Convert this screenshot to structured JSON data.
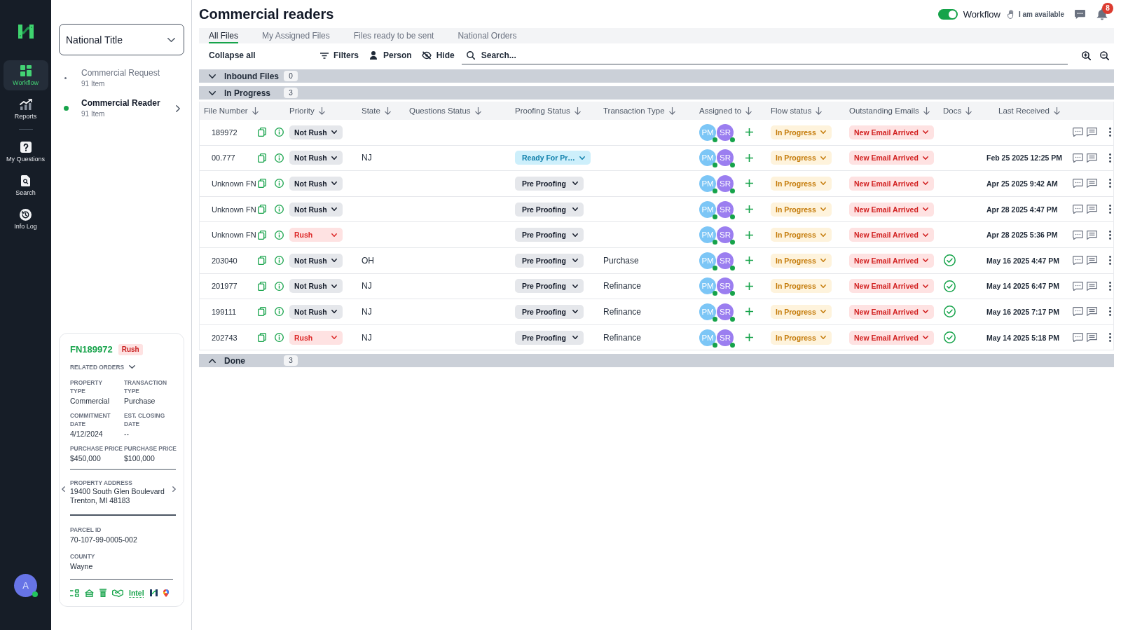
{
  "rail": {
    "nav": [
      {
        "label": "Workflow",
        "selected": true
      },
      {
        "label": "Reports",
        "selected": false
      },
      {
        "label": "My Questions",
        "selected": false
      },
      {
        "label": "Search",
        "selected": false
      },
      {
        "label": "Info Log",
        "selected": false
      }
    ],
    "user_avatar": {
      "initial": "A",
      "online": true
    }
  },
  "panel": {
    "organization_select": {
      "value": "National Title"
    },
    "queues": [
      {
        "name": "Commercial Request",
        "count": "91 Item",
        "selected": false
      },
      {
        "name": "Commercial Reader",
        "count": "91 Item",
        "selected": true
      }
    ],
    "file_card": {
      "file_number": "FN189972",
      "priority": {
        "label": "Rush",
        "kind": "rush"
      },
      "related_orders": {
        "label": "RELATED ORDERS",
        "expanded": false
      },
      "fields": [
        {
          "label": "PROPERTY\nTYPE",
          "value": "Commercial"
        },
        {
          "label": "TRANSACTION\nTYPE",
          "value": "Purchase"
        },
        {
          "label": "COMMITMENT\nDATE",
          "value": "4/12/2024"
        },
        {
          "label": "EST. CLOSING\nDATE",
          "value": "--"
        },
        {
          "label": "PURCHASE PRICE",
          "value": "$450,000"
        },
        {
          "label": "PURCHASE PRICE",
          "value": "$100,000"
        }
      ],
      "address": {
        "label": "PROPERTY ADDRESS",
        "lines": [
          "19400 South Glen Boulevard",
          "Trenton, MI 48183"
        ]
      },
      "details": [
        {
          "label": "PARCEL ID",
          "value": "70-107-99-0005-002"
        },
        {
          "label": "COUNTY",
          "value": "Wayne"
        }
      ],
      "intel_link": "Intel"
    }
  },
  "header": {
    "title": "Commercial readers",
    "workflow_toggle": {
      "label": "Workflow",
      "on": true
    },
    "availability": "I am available",
    "notifications": {
      "count": "8"
    }
  },
  "tabs": [
    {
      "label": "All Files",
      "selected": true
    },
    {
      "label": "My Assigned Files",
      "selected": false
    },
    {
      "label": "Files ready to be sent",
      "selected": false
    },
    {
      "label": "National Orders",
      "selected": false
    }
  ],
  "toolbar": {
    "collapse_all": "Collapse all",
    "filters": "Filters",
    "person": "Person",
    "hide": "Hide",
    "search": {
      "placeholder": "Search..."
    }
  },
  "groups": [
    {
      "name": "Inbound Files",
      "count": "0",
      "expanded": true
    },
    {
      "name": "In Progress",
      "count": "3",
      "expanded": true,
      "table": {
        "columns": [
          "File Number",
          "Priority",
          "State",
          "Questions Status",
          "Proofing Status",
          "Transaction Type",
          "Assigned to",
          "Flow status",
          "Outstanding Emails",
          "Docs",
          "Last Received"
        ],
        "rows": [
          {
            "file_number": "189972",
            "priority": {
              "label": "Not Rush",
              "kind": "not_rush"
            },
            "assignees": [
              {
                "initials": "PM",
                "color": "#7cc6f6",
                "online": true
              },
              {
                "initials": "SR",
                "color": "#9b7ef0",
                "online": true
              }
            ],
            "flow_status": "In Progress",
            "outstanding_emails": "New Email Arrived",
            "docs_checked": false
          },
          {
            "file_number": "00.777",
            "priority": {
              "label": "Not Rush",
              "kind": "not_rush"
            },
            "state": "NJ",
            "proofing_status": {
              "label": "Ready For Pr…",
              "kind": "ready"
            },
            "assignees": [
              {
                "initials": "PM",
                "color": "#7cc6f6",
                "online": true
              },
              {
                "initials": "SR",
                "color": "#9b7ef0",
                "online": true
              }
            ],
            "flow_status": "In Progress",
            "outstanding_emails": "New Email Arrived",
            "docs_checked": false,
            "last_received": "Feb 25 2025 12:25 PM"
          },
          {
            "file_number": "Unknown FN",
            "priority": {
              "label": "Not Rush",
              "kind": "not_rush"
            },
            "proofing_status": {
              "label": "Pre Proofing",
              "kind": "pre"
            },
            "assignees": [
              {
                "initials": "PM",
                "color": "#7cc6f6",
                "online": true
              },
              {
                "initials": "SR",
                "color": "#9b7ef0",
                "online": true
              }
            ],
            "flow_status": "In Progress",
            "outstanding_emails": "New Email Arrived",
            "docs_checked": false,
            "last_received": "Apr 25 2025 9:42 AM"
          },
          {
            "file_number": "Unknown FN",
            "priority": {
              "label": "Not Rush",
              "kind": "not_rush"
            },
            "proofing_status": {
              "label": "Pre Proofing",
              "kind": "pre"
            },
            "assignees": [
              {
                "initials": "PM",
                "color": "#7cc6f6",
                "online": true
              },
              {
                "initials": "SR",
                "color": "#9b7ef0",
                "online": true
              }
            ],
            "flow_status": "In Progress",
            "outstanding_emails": "New Email Arrived",
            "docs_checked": false,
            "last_received": "Apr 28 2025 4:47 PM"
          },
          {
            "file_number": "Unknown FN",
            "priority": {
              "label": "Rush",
              "kind": "rush"
            },
            "proofing_status": {
              "label": "Pre Proofing",
              "kind": "pre"
            },
            "assignees": [
              {
                "initials": "PM",
                "color": "#7cc6f6",
                "online": true
              },
              {
                "initials": "SR",
                "color": "#9b7ef0",
                "online": true
              }
            ],
            "flow_status": "In Progress",
            "outstanding_emails": "New Email Arrived",
            "docs_checked": false,
            "last_received": "Apr 28 2025 5:36 PM"
          },
          {
            "file_number": "203040",
            "priority": {
              "label": "Not Rush",
              "kind": "not_rush"
            },
            "state": "OH",
            "proofing_status": {
              "label": "Pre Proofing",
              "kind": "pre"
            },
            "transaction_type": "Purchase",
            "assignees": [
              {
                "initials": "PM",
                "color": "#7cc6f6",
                "online": true
              },
              {
                "initials": "SR",
                "color": "#9b7ef0",
                "online": true
              }
            ],
            "flow_status": "In Progress",
            "outstanding_emails": "New Email Arrived",
            "docs_checked": true,
            "last_received": "May 16 2025 4:47 PM"
          },
          {
            "file_number": "201977",
            "priority": {
              "label": "Not Rush",
              "kind": "not_rush"
            },
            "state": "NJ",
            "proofing_status": {
              "label": "Pre Proofing",
              "kind": "pre"
            },
            "transaction_type": "Refinance",
            "assignees": [
              {
                "initials": "PM",
                "color": "#7cc6f6",
                "online": true
              },
              {
                "initials": "SR",
                "color": "#9b7ef0",
                "online": true
              }
            ],
            "flow_status": "In Progress",
            "outstanding_emails": "New Email Arrived",
            "docs_checked": true,
            "last_received": "May 14 2025 6:47 PM"
          },
          {
            "file_number": "199111",
            "priority": {
              "label": "Not Rush",
              "kind": "not_rush"
            },
            "state": "NJ",
            "proofing_status": {
              "label": "Pre Proofing",
              "kind": "pre"
            },
            "transaction_type": "Refinance",
            "assignees": [
              {
                "initials": "PM",
                "color": "#7cc6f6",
                "online": true
              },
              {
                "initials": "SR",
                "color": "#9b7ef0",
                "online": true
              }
            ],
            "flow_status": "In Progress",
            "outstanding_emails": "New Email Arrived",
            "docs_checked": true,
            "last_received": "May 16 2025 7:17 PM"
          },
          {
            "file_number": "202743",
            "priority": {
              "label": "Rush",
              "kind": "rush"
            },
            "state": "NJ",
            "proofing_status": {
              "label": "Pre Proofing",
              "kind": "pre"
            },
            "transaction_type": "Refinance",
            "assignees": [
              {
                "initials": "PM",
                "color": "#7cc6f6",
                "online": true
              },
              {
                "initials": "SR",
                "color": "#9b7ef0",
                "online": true
              }
            ],
            "flow_status": "In Progress",
            "outstanding_emails": "New Email Arrived",
            "docs_checked": true,
            "last_received": "May 14 2025 5:18 PM"
          }
        ]
      }
    },
    {
      "name": "Done",
      "count": "3",
      "expanded": false
    }
  ]
}
